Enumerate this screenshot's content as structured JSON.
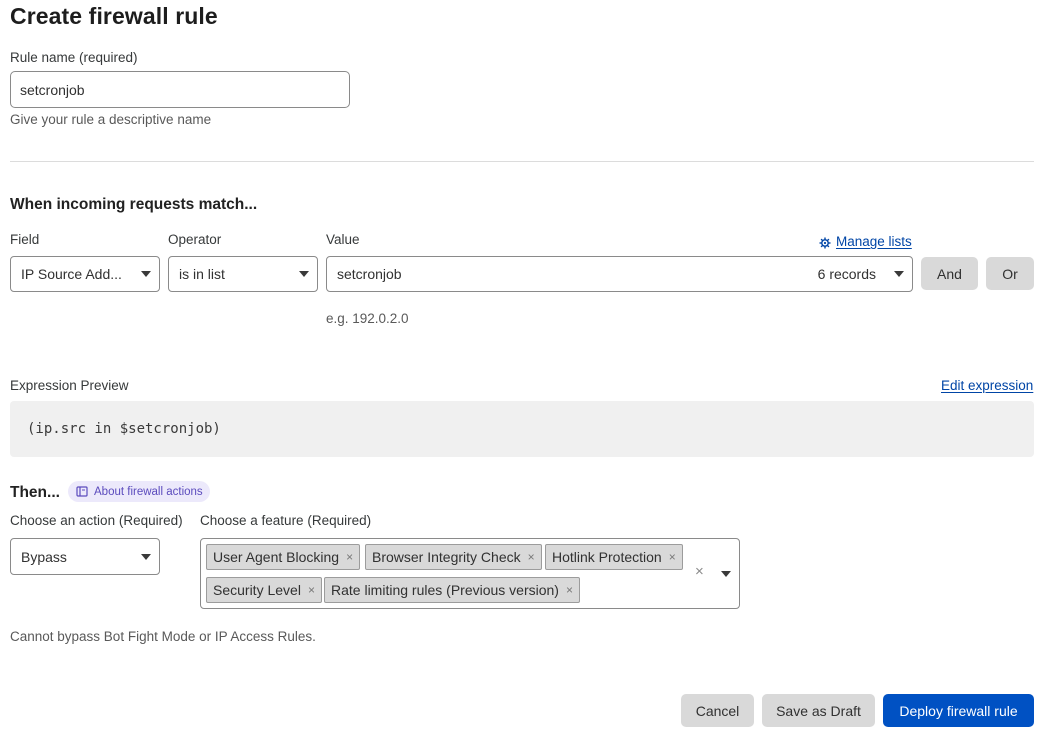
{
  "page": {
    "title": "Create firewall rule"
  },
  "rule_name": {
    "label": "Rule name (required)",
    "value": "setcronjob",
    "help": "Give your rule a descriptive name"
  },
  "match": {
    "heading": "When incoming requests match...",
    "field_label": "Field",
    "operator_label": "Operator",
    "value_label": "Value",
    "manage_lists": "Manage lists",
    "field_value": "IP Source Add...",
    "operator_value": "is in list",
    "value_value": "setcronjob",
    "value_records": "6 records",
    "and_label": "And",
    "or_label": "Or",
    "value_hint": "e.g. 192.0.2.0"
  },
  "expression": {
    "label": "Expression Preview",
    "edit_label": "Edit expression",
    "code": "(ip.src in $setcronjob)"
  },
  "then": {
    "heading": "Then...",
    "about_label": "About firewall actions",
    "action_label": "Choose an action (Required)",
    "feature_label": "Choose a feature (Required)",
    "action_value": "Bypass",
    "features": [
      "User Agent Blocking",
      "Browser Integrity Check",
      "Hotlink Protection",
      "Security Level",
      "Rate limiting rules (Previous version)"
    ],
    "note": "Cannot bypass Bot Fight Mode or IP Access Rules."
  },
  "footer": {
    "cancel": "Cancel",
    "save_draft": "Save as Draft",
    "deploy": "Deploy firewall rule"
  },
  "colors": {
    "primary": "#0051c3",
    "link": "#0045a6",
    "secondary_button": "#d9d9d9",
    "pill_bg": "#ece9fb",
    "pill_text": "#5b4bbd"
  }
}
